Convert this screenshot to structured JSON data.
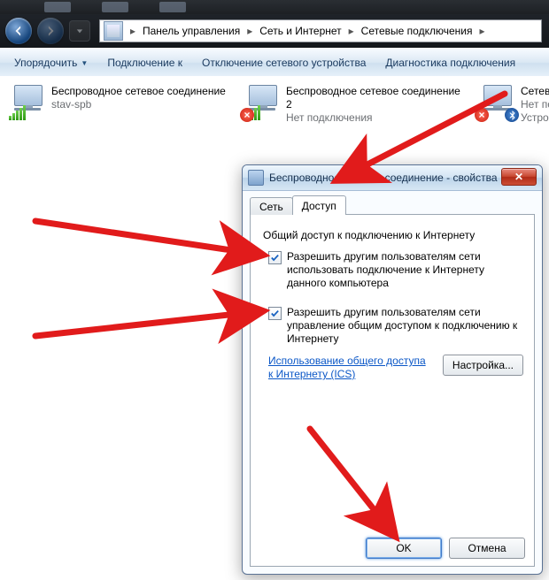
{
  "breadcrumb": {
    "parts": [
      "Панель управления",
      "Сеть и Интернет",
      "Сетевые подключения"
    ]
  },
  "toolbar": {
    "organize": "Упорядочить",
    "connect_to": "Подключение к",
    "disable_device": "Отключение сетевого устройства",
    "diagnose": "Диагностика подключения"
  },
  "connections": {
    "c1": {
      "name": "Беспроводное сетевое соединение",
      "sub": "stav-spb"
    },
    "c2": {
      "name": "Беспроводное сетевое соединение 2",
      "sub": "Нет подключения"
    },
    "c3": {
      "name": "Сетевое п",
      "sub1": "Нет подк",
      "sub2": "Устройст"
    }
  },
  "dialog": {
    "title": "Беспроводное сетевое соединение - свойства",
    "tabs": {
      "net": "Сеть",
      "share": "Доступ"
    },
    "group": "Общий доступ к подключению к Интернету",
    "chk1": "Разрешить другим пользователям сети использовать подключение к Интернету данного компьютера",
    "chk2": "Разрешить другим пользователям сети управление общим доступом к подключению к Интернету",
    "link": "Использование общего доступа к Интернету (ICS)",
    "settings_btn": "Настройка...",
    "ok": "OK",
    "cancel": "Отмена"
  },
  "colors": {
    "arrow": "#e11b1b"
  }
}
